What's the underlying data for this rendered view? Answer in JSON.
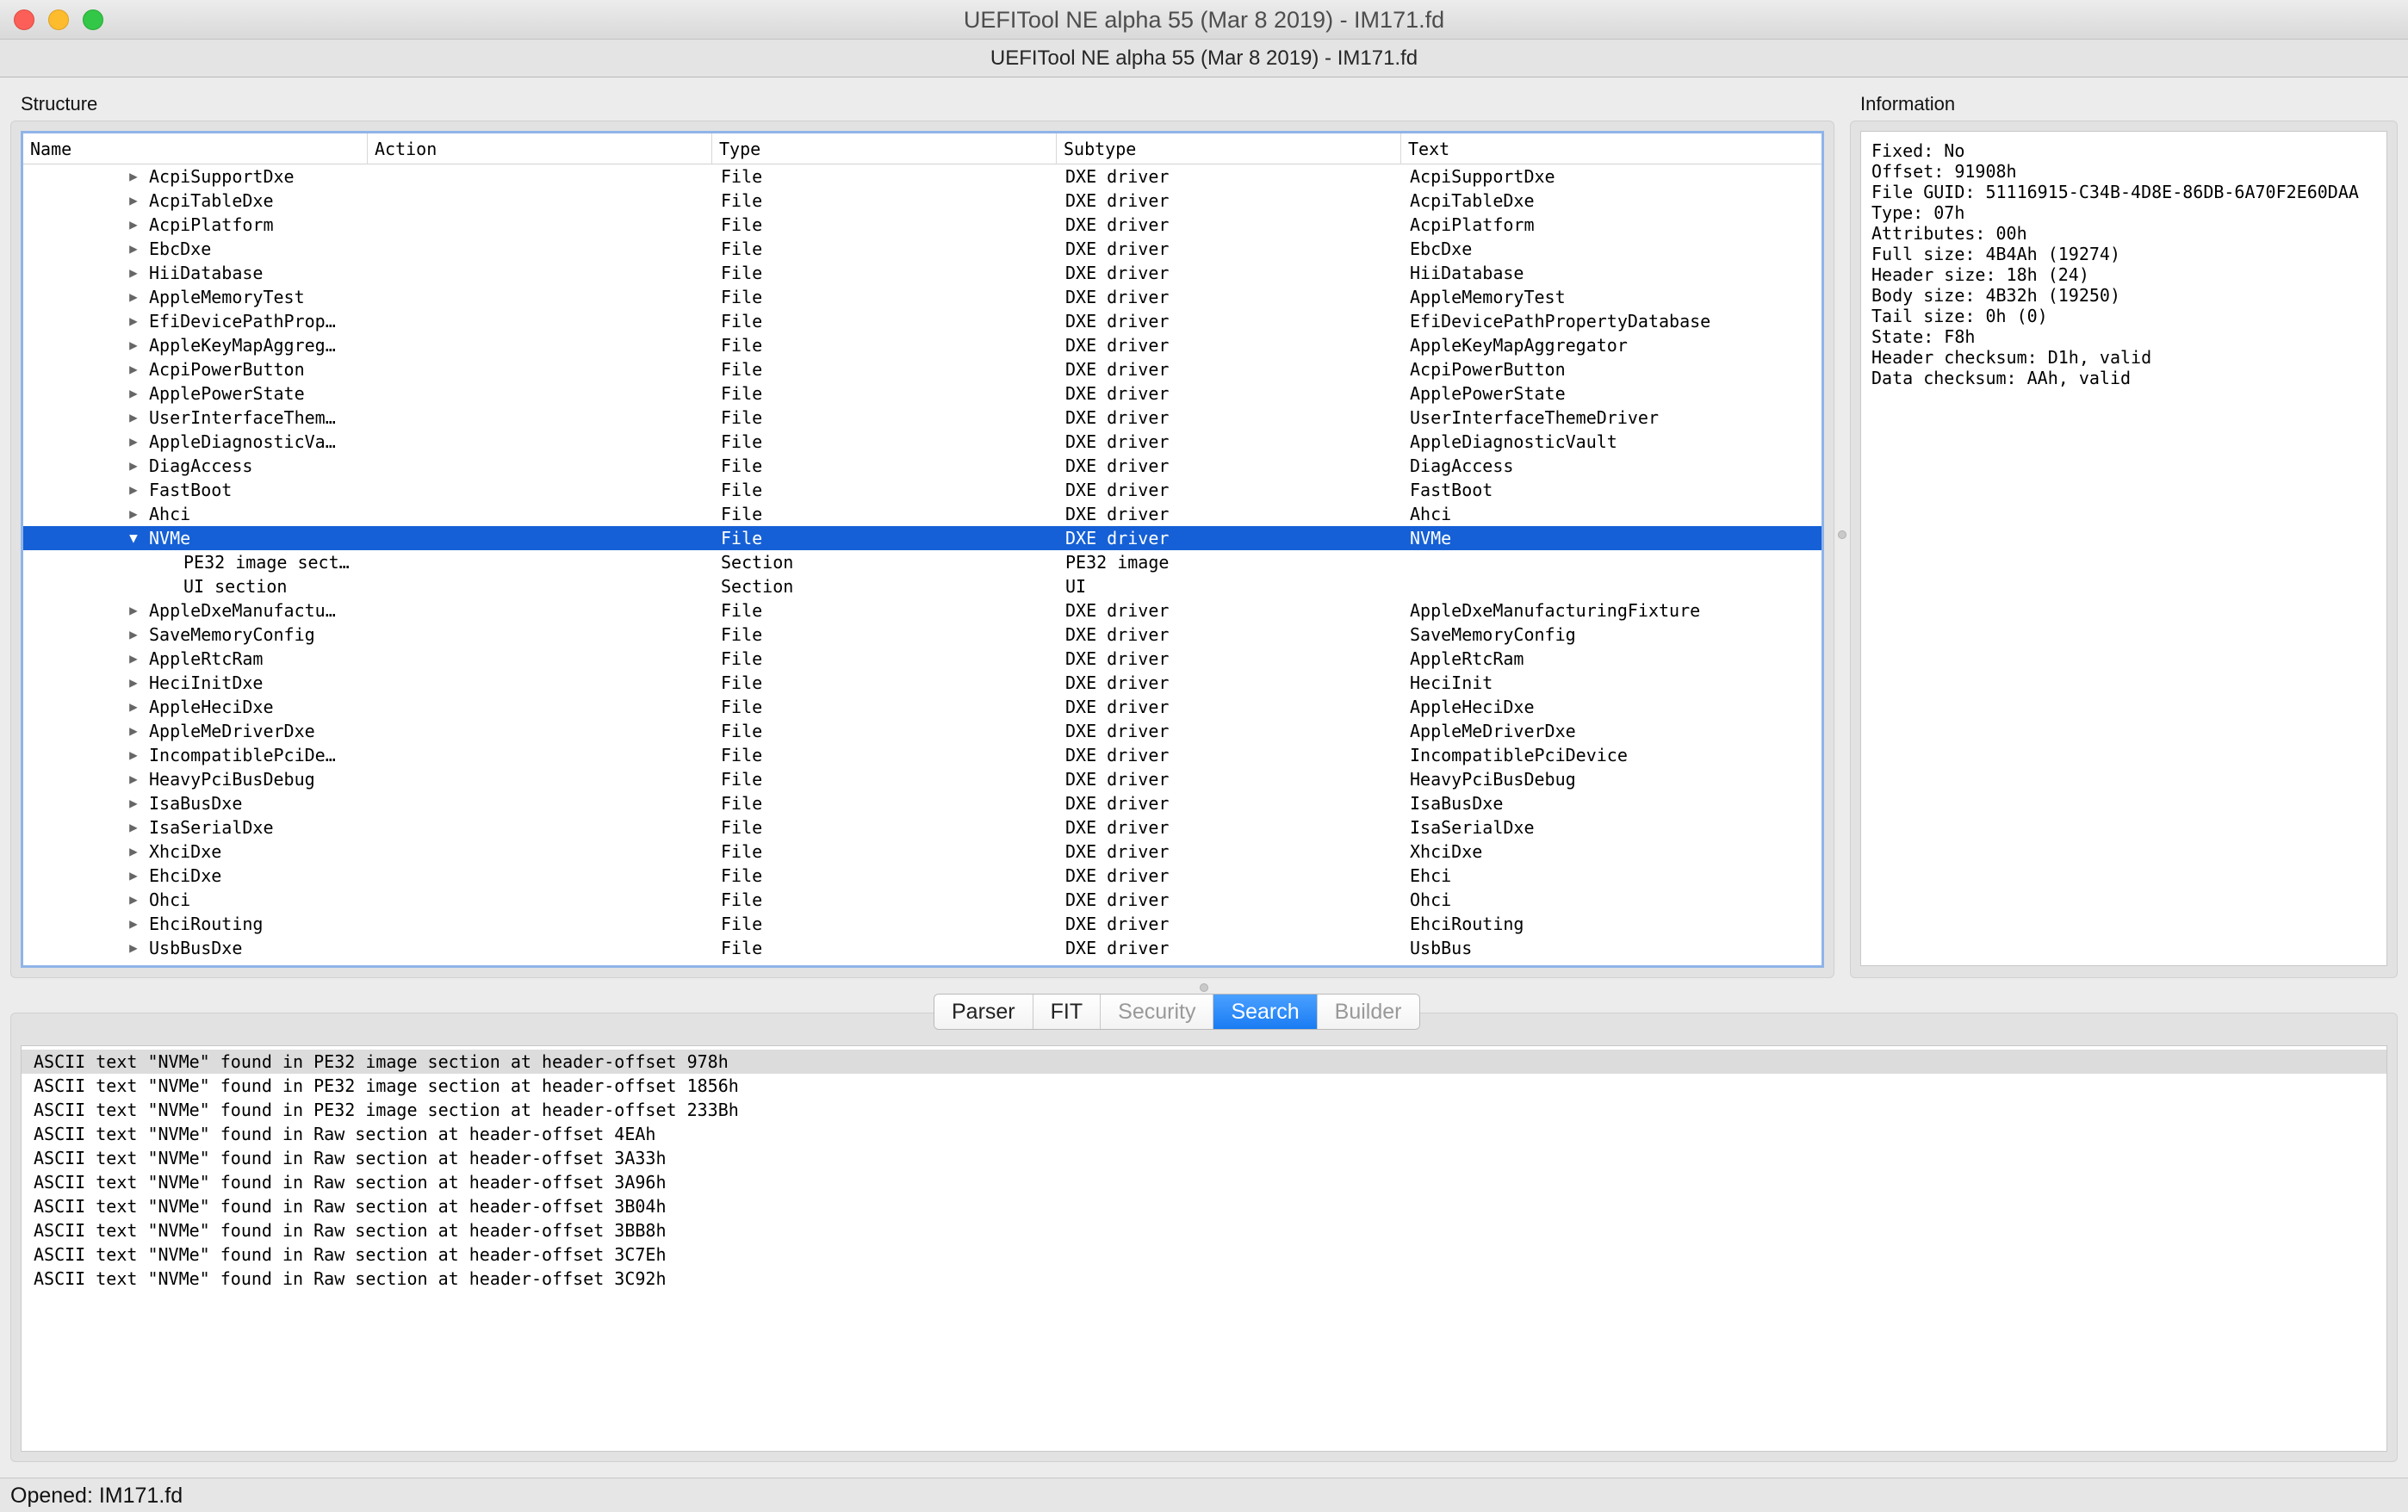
{
  "window": {
    "title": "UEFITool NE alpha 55 (Mar  8 2019) - IM171.fd"
  },
  "subtitle": "UEFITool NE alpha 55 (Mar  8 2019) - IM171.fd",
  "structure": {
    "label": "Structure",
    "columns": [
      "Name",
      "Action",
      "Type",
      "Subtype",
      "Text"
    ],
    "rows": [
      {
        "name": "AcpiSupportDxe",
        "type": "File",
        "subtype": "DXE driver",
        "text": "AcpiSupportDxe",
        "expander": "collapsed",
        "level": 1,
        "selected": false
      },
      {
        "name": "AcpiTableDxe",
        "type": "File",
        "subtype": "DXE driver",
        "text": "AcpiTableDxe",
        "expander": "collapsed",
        "level": 1,
        "selected": false
      },
      {
        "name": "AcpiPlatform",
        "type": "File",
        "subtype": "DXE driver",
        "text": "AcpiPlatform",
        "expander": "collapsed",
        "level": 1,
        "selected": false
      },
      {
        "name": "EbcDxe",
        "type": "File",
        "subtype": "DXE driver",
        "text": "EbcDxe",
        "expander": "collapsed",
        "level": 1,
        "selected": false
      },
      {
        "name": "HiiDatabase",
        "type": "File",
        "subtype": "DXE driver",
        "text": "HiiDatabase",
        "expander": "collapsed",
        "level": 1,
        "selected": false
      },
      {
        "name": "AppleMemoryTest",
        "type": "File",
        "subtype": "DXE driver",
        "text": "AppleMemoryTest",
        "expander": "collapsed",
        "level": 1,
        "selected": false
      },
      {
        "name": "EfiDevicePathProp…",
        "type": "File",
        "subtype": "DXE driver",
        "text": "EfiDevicePathPropertyDatabase",
        "expander": "collapsed",
        "level": 1,
        "selected": false
      },
      {
        "name": "AppleKeyMapAggreg…",
        "type": "File",
        "subtype": "DXE driver",
        "text": "AppleKeyMapAggregator",
        "expander": "collapsed",
        "level": 1,
        "selected": false
      },
      {
        "name": "AcpiPowerButton",
        "type": "File",
        "subtype": "DXE driver",
        "text": "AcpiPowerButton",
        "expander": "collapsed",
        "level": 1,
        "selected": false
      },
      {
        "name": "ApplePowerState",
        "type": "File",
        "subtype": "DXE driver",
        "text": "ApplePowerState",
        "expander": "collapsed",
        "level": 1,
        "selected": false
      },
      {
        "name": "UserInterfaceThem…",
        "type": "File",
        "subtype": "DXE driver",
        "text": "UserInterfaceThemeDriver",
        "expander": "collapsed",
        "level": 1,
        "selected": false
      },
      {
        "name": "AppleDiagnosticVa…",
        "type": "File",
        "subtype": "DXE driver",
        "text": "AppleDiagnosticVault",
        "expander": "collapsed",
        "level": 1,
        "selected": false
      },
      {
        "name": "DiagAccess",
        "type": "File",
        "subtype": "DXE driver",
        "text": "DiagAccess",
        "expander": "collapsed",
        "level": 1,
        "selected": false
      },
      {
        "name": "FastBoot",
        "type": "File",
        "subtype": "DXE driver",
        "text": "FastBoot",
        "expander": "collapsed",
        "level": 1,
        "selected": false
      },
      {
        "name": "Ahci",
        "type": "File",
        "subtype": "DXE driver",
        "text": "Ahci",
        "expander": "collapsed",
        "level": 1,
        "selected": false
      },
      {
        "name": "NVMe",
        "type": "File",
        "subtype": "DXE driver",
        "text": "NVMe",
        "expander": "expanded",
        "level": 1,
        "selected": true
      },
      {
        "name": "PE32 image sect…",
        "type": "Section",
        "subtype": "PE32 image",
        "text": "",
        "expander": "none",
        "level": 2,
        "selected": false
      },
      {
        "name": "UI section",
        "type": "Section",
        "subtype": "UI",
        "text": "",
        "expander": "none",
        "level": 2,
        "selected": false
      },
      {
        "name": "AppleDxeManufactu…",
        "type": "File",
        "subtype": "DXE driver",
        "text": "AppleDxeManufacturingFixture",
        "expander": "collapsed",
        "level": 1,
        "selected": false
      },
      {
        "name": "SaveMemoryConfig",
        "type": "File",
        "subtype": "DXE driver",
        "text": "SaveMemoryConfig",
        "expander": "collapsed",
        "level": 1,
        "selected": false
      },
      {
        "name": "AppleRtcRam",
        "type": "File",
        "subtype": "DXE driver",
        "text": "AppleRtcRam",
        "expander": "collapsed",
        "level": 1,
        "selected": false
      },
      {
        "name": "HeciInitDxe",
        "type": "File",
        "subtype": "DXE driver",
        "text": "HeciInit",
        "expander": "collapsed",
        "level": 1,
        "selected": false
      },
      {
        "name": "AppleHeciDxe",
        "type": "File",
        "subtype": "DXE driver",
        "text": "AppleHeciDxe",
        "expander": "collapsed",
        "level": 1,
        "selected": false
      },
      {
        "name": "AppleMeDriverDxe",
        "type": "File",
        "subtype": "DXE driver",
        "text": "AppleMeDriverDxe",
        "expander": "collapsed",
        "level": 1,
        "selected": false
      },
      {
        "name": "IncompatiblePciDe…",
        "type": "File",
        "subtype": "DXE driver",
        "text": "IncompatiblePciDevice",
        "expander": "collapsed",
        "level": 1,
        "selected": false
      },
      {
        "name": "HeavyPciBusDebug",
        "type": "File",
        "subtype": "DXE driver",
        "text": "HeavyPciBusDebug",
        "expander": "collapsed",
        "level": 1,
        "selected": false
      },
      {
        "name": "IsaBusDxe",
        "type": "File",
        "subtype": "DXE driver",
        "text": "IsaBusDxe",
        "expander": "collapsed",
        "level": 1,
        "selected": false
      },
      {
        "name": "IsaSerialDxe",
        "type": "File",
        "subtype": "DXE driver",
        "text": "IsaSerialDxe",
        "expander": "collapsed",
        "level": 1,
        "selected": false
      },
      {
        "name": "XhciDxe",
        "type": "File",
        "subtype": "DXE driver",
        "text": "XhciDxe",
        "expander": "collapsed",
        "level": 1,
        "selected": false
      },
      {
        "name": "EhciDxe",
        "type": "File",
        "subtype": "DXE driver",
        "text": "Ehci",
        "expander": "collapsed",
        "level": 1,
        "selected": false
      },
      {
        "name": "Ohci",
        "type": "File",
        "subtype": "DXE driver",
        "text": "Ohci",
        "expander": "collapsed",
        "level": 1,
        "selected": false
      },
      {
        "name": "EhciRouting",
        "type": "File",
        "subtype": "DXE driver",
        "text": "EhciRouting",
        "expander": "collapsed",
        "level": 1,
        "selected": false
      },
      {
        "name": "UsbBusDxe",
        "type": "File",
        "subtype": "DXE driver",
        "text": "UsbBus",
        "expander": "collapsed",
        "level": 1,
        "selected": false
      }
    ]
  },
  "information": {
    "label": "Information",
    "lines": [
      "Fixed: No",
      "Offset: 91908h",
      "File GUID: 51116915-C34B-4D8E-86DB-6A70F2E60DAA",
      "Type: 07h",
      "Attributes: 00h",
      "Full size: 4B4Ah (19274)",
      "Header size: 18h (24)",
      "Body size: 4B32h (19250)",
      "Tail size: 0h (0)",
      "State: F8h",
      "Header checksum: D1h, valid",
      "Data checksum: AAh, valid"
    ]
  },
  "tabs": [
    {
      "label": "Parser",
      "state": "normal"
    },
    {
      "label": "FIT",
      "state": "normal"
    },
    {
      "label": "Security",
      "state": "disabled"
    },
    {
      "label": "Search",
      "state": "active"
    },
    {
      "label": "Builder",
      "state": "disabled"
    }
  ],
  "search_results": [
    "ASCII text \"NVMe\" found in PE32 image section at header-offset 978h",
    "ASCII text \"NVMe\" found in PE32 image section at header-offset 1856h",
    "ASCII text \"NVMe\" found in PE32 image section at header-offset 233Bh",
    "ASCII text \"NVMe\" found in Raw section at header-offset 4EAh",
    "ASCII text \"NVMe\" found in Raw section at header-offset 3A33h",
    "ASCII text \"NVMe\" found in Raw section at header-offset 3A96h",
    "ASCII text \"NVMe\" found in Raw section at header-offset 3B04h",
    "ASCII text \"NVMe\" found in Raw section at header-offset 3BB8h",
    "ASCII text \"NVMe\" found in Raw section at header-offset 3C7Eh",
    "ASCII text \"NVMe\" found in Raw section at header-offset 3C92h"
  ],
  "status": "Opened: IM171.fd"
}
